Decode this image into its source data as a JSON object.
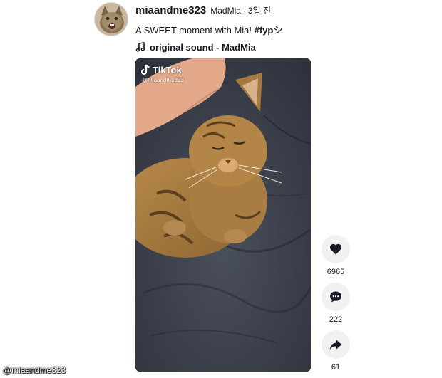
{
  "post": {
    "username": "miaandme323",
    "nickname": "MadMia",
    "separator": "·",
    "date": "3일 전",
    "caption_text": "A SWEET moment with Mia! ",
    "hashtag": "#fyp",
    "hashtag_suffix": "シ",
    "music_title": "original sound - MadMia"
  },
  "video": {
    "watermark_brand": "TikTok",
    "watermark_handle": "@miaandme323"
  },
  "actions": {
    "like": {
      "icon": "heart-icon",
      "count": "6965"
    },
    "comment": {
      "icon": "comment-icon",
      "count": "222"
    },
    "share": {
      "icon": "share-icon",
      "count": "61"
    }
  },
  "footer": {
    "credit": "@miaandme323"
  },
  "colors": {
    "text": "#161823",
    "button_bg": "#f1f1f2",
    "video_bg": "#3b3f4a"
  }
}
